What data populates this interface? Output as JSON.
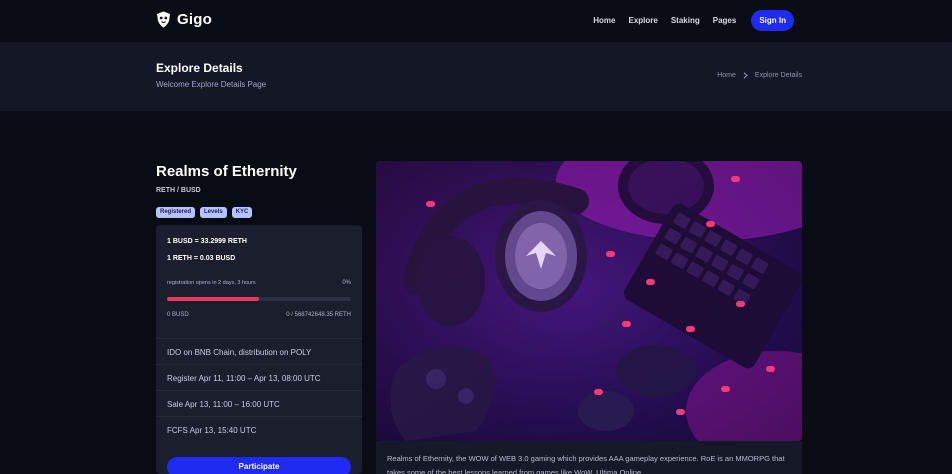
{
  "header": {
    "brand": "Gigo",
    "nav": [
      "Home",
      "Explore",
      "Staking",
      "Pages"
    ],
    "signin_label": "Sign In"
  },
  "banner": {
    "title": "Explore Details",
    "subtitle": "Welcome Explore Details Page",
    "breadcrumb": [
      "Home",
      "Explore Details"
    ]
  },
  "project": {
    "title": "Realms of Ethernity",
    "pair": "RETH / BUSD",
    "tags": [
      "Registered",
      "Levels",
      "KYC"
    ],
    "rate1": "1 BUSD = 33.2999 RETH",
    "rate2": "1 RETH = 0.03 BUSD",
    "registration_note": "registration opens in 2 days, 3 hours",
    "registration_percent": "0%",
    "progress_fraction": 0.5,
    "raised_left": "0 BUSD",
    "raised_right": "0 / 568742648.35 RETH",
    "info": [
      "IDO on BNB Chain, distribution on POLY",
      "Register Apr 11, 11:00 – Apr 13, 08:00 UTC",
      "Sale Apr 13, 11:00 – 16:00 UTC",
      "FCFS Apr 13, 15:40 UTC"
    ],
    "participate_label": "Participate",
    "description": "Realms of Ethernity, the WOW of WEB 3.0 gaming which provides AAA gameplay experience. RoE is an MMORPG that takes some of the best lessons learned from games like WoW, Ultima Online."
  },
  "colors": {
    "accent": "#1f2bf0",
    "progress": "#e8385f",
    "tag": "#b7c3ff"
  }
}
